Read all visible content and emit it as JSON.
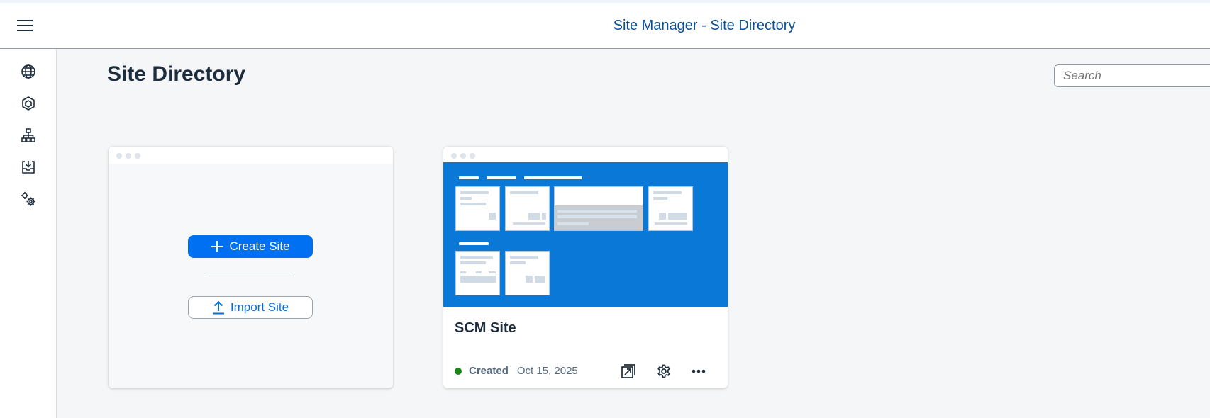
{
  "shell": {
    "title": "Site Manager - Site Directory"
  },
  "sidenav": {
    "items": [
      {
        "icon": "globe-icon"
      },
      {
        "icon": "cube-icon"
      },
      {
        "icon": "hierarchy-icon"
      },
      {
        "icon": "inbox-download-icon"
      },
      {
        "icon": "gears-icon"
      }
    ]
  },
  "page": {
    "title": "Site Directory"
  },
  "search": {
    "placeholder": "Search"
  },
  "create_card": {
    "create_label": "Create Site",
    "import_label": "Import Site"
  },
  "site_card": {
    "name": "SCM Site",
    "status": "Created",
    "date": "Oct 15, 2025",
    "status_color": "#188918",
    "actions": [
      "open-external-icon",
      "settings-icon",
      "more-icon"
    ]
  },
  "colors": {
    "accent": "#0070f2",
    "preview_bg": "#0a78d6",
    "link": "#0a4f96"
  }
}
